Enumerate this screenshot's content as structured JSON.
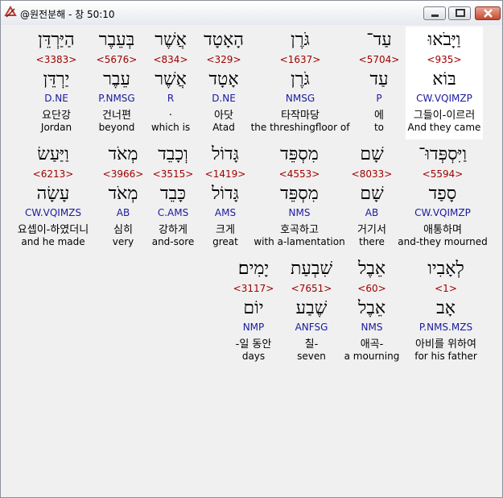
{
  "window": {
    "title": "@원전분해 - 창 50:10"
  },
  "rows": [
    [
      {
        "heb": "וַיָּבֹאוּ",
        "strong": "<935>",
        "lemma": "בּוֹא",
        "morph": "CW.VQIMZP",
        "korean": "그들이-이르러",
        "english": "And they came",
        "selected": true
      },
      {
        "heb": "עַד־",
        "strong": "<5704>",
        "lemma": "עַד",
        "morph": "P",
        "korean": "에",
        "english": "to"
      },
      {
        "heb": "גֹּרֶן",
        "strong": "<1637>",
        "lemma": "גֹּרֶן",
        "morph": "NMSG",
        "korean": "타작마당",
        "english": "the threshingfloor of"
      },
      {
        "heb": "הָאָטָד",
        "strong": "<329>",
        "lemma": "אָטָד",
        "morph": "D.NE",
        "korean": "아닷",
        "english": "Atad"
      },
      {
        "heb": "אֲשֶׁר",
        "strong": "<834>",
        "lemma": "אֲשֶׁר",
        "morph": "R",
        "korean": ".",
        "english": "which is"
      },
      {
        "heb": "בְּעֵבֶר",
        "strong": "<5676>",
        "lemma": "עֵבֶר",
        "morph": "P.NMSG",
        "korean": "건너편",
        "english": "beyond"
      },
      {
        "heb": "הַיַּרְדֵּן",
        "strong": "<3383>",
        "lemma": "יַרְדֵּן",
        "morph": "D.NE",
        "korean": "요단강",
        "english": "Jordan"
      }
    ],
    [
      {
        "heb": "וַיִּסְפְּדוּ־",
        "strong": "<5594>",
        "lemma": "סָפַד",
        "morph": "CW.VQIMZP",
        "korean": "애통하며",
        "english": "and-they mourned"
      },
      {
        "heb": "שָׁם",
        "strong": "<8033>",
        "lemma": "שָׁם",
        "morph": "AB",
        "korean": "거기서",
        "english": "there"
      },
      {
        "heb": "מִסְפֵּד",
        "strong": "<4553>",
        "lemma": "מִסְפֵּד",
        "morph": "NMS",
        "korean": "호곡하고",
        "english": "with a-lamentation"
      },
      {
        "heb": "גָּדוֹל",
        "strong": "<1419>",
        "lemma": "גָּדוֹל",
        "morph": "AMS",
        "korean": "크게",
        "english": "great"
      },
      {
        "heb": "וְכָבֵד",
        "strong": "<3515>",
        "lemma": "כָּבֵד",
        "morph": "C.AMS",
        "korean": "강하게",
        "english": "and-sore"
      },
      {
        "heb": "מְאֹד",
        "strong": "<3966>",
        "lemma": "מְאֹד",
        "morph": "AB",
        "korean": "심히",
        "english": "very"
      },
      {
        "heb": "וַיַּעַשׂ",
        "strong": "<6213>",
        "lemma": "עָשָׂה",
        "morph": "CW.VQIMZS",
        "korean": "요셉이-하였더니",
        "english": "and he made"
      }
    ],
    [
      {
        "heb": "לְאָבִיו",
        "strong": "<1>",
        "lemma": "אָב",
        "morph": "P.NMS.MZS",
        "korean": "아비를 위하여",
        "english": "for his father"
      },
      {
        "heb": "אֵבֶל",
        "strong": "<60>",
        "lemma": "אֵבֶל",
        "morph": "NMS",
        "korean": "애곡-",
        "english": "a mourning"
      },
      {
        "heb": "שִׁבְעַת",
        "strong": "<7651>",
        "lemma": "שֶׁבַע",
        "morph": "ANFSG",
        "korean": "칠-",
        "english": "seven"
      },
      {
        "heb": "יָמִים׃",
        "strong": "<3117>",
        "lemma": "יוֹם",
        "morph": "NMP",
        "korean": "-일 동안",
        "english": "days"
      }
    ]
  ]
}
